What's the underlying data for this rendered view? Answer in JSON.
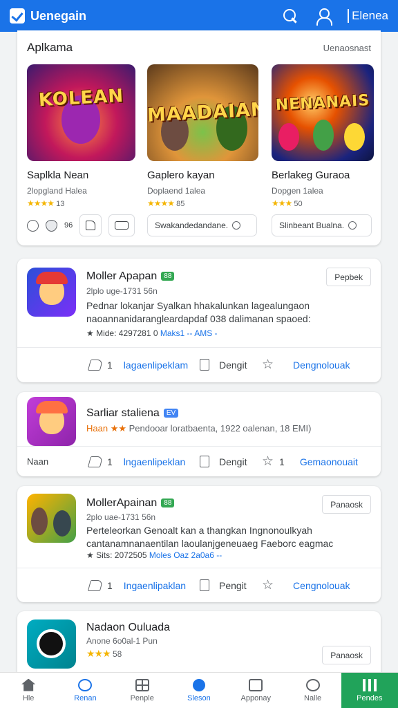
{
  "header": {
    "app_title": "Uenegain",
    "link_label": "Elenea"
  },
  "featured": {
    "title": "Aplkama",
    "more": "Uenaosnast",
    "items": [
      {
        "banner_text": "KOLEAN",
        "name": "Saplkla Nean",
        "sub": "2lopgland Halea",
        "stars": "★★★★",
        "rating": "13"
      },
      {
        "banner_text": "MAADAIAN",
        "name": "Gaplero kayan",
        "sub": "Doplaend 1alea",
        "stars": "★★★★",
        "rating": "85"
      },
      {
        "banner_text": "NENANAIS",
        "name": "Berlakeg Guraoa",
        "sub": "Dopgen 1alea",
        "stars": "★★★",
        "rating": "50"
      }
    ],
    "mini_count": "96",
    "actions": [
      "Swakandedandane.",
      "Slinbeant Bualna."
    ]
  },
  "apps": [
    {
      "name": "Moller Apapan",
      "tag": "88",
      "meta": "2lplo uge-1731 56n",
      "desc": "Pednar lokanjar Syalkan hhakalunkan lagealungaon naoannanidarangleardapdaf 038 dalimanan spaoed:",
      "stats_prefix": "★ Mide:",
      "stats_value": "4297281 0",
      "stats_link": "Maks1 -- AMS -",
      "button": "Pepbek",
      "share_count": "1",
      "share_label": "lagaenlipeklam",
      "doc_label": "Dengit",
      "star_label": "Dengnolouak"
    },
    {
      "name": "Sarliar staliena",
      "tag": "EV",
      "meta_prefix": "Haan ★★",
      "meta": "Pendooar loratbaenta, 1922 oalenan, 18 EMI)",
      "lead": "Naan",
      "share_count": "1",
      "share_label": "lngaenlipeklan",
      "doc_label": "Dengit",
      "star_count": "1",
      "star_label": "Gemaonouait"
    },
    {
      "name": "MollerApainan",
      "tag": "88",
      "meta": "2plo uae-1731 56n",
      "desc": "Perteleorkan Genoalt kan a thangkan Ingnonoulkyah cantanamnanaentilan laoulanjgeneuaeg Faeborc eagmac",
      "stats_prefix": "★ Sits:",
      "stats_value": "2072505",
      "stats_link": "Moles Oaz 2a0a6 --",
      "button": "Panaosk",
      "share_count": "1",
      "share_label": "Ingaenlipaklan",
      "doc_label": "Pengit",
      "star_label": "Cengnolouak"
    },
    {
      "name": "Nadaon Ouluada",
      "meta": "Anone 6o0al-1 Pun",
      "stars": "★★★",
      "rating": "58",
      "button": "Panaosk"
    }
  ],
  "bottom_nav": [
    {
      "label": "Hle",
      "icon": "home-icon"
    },
    {
      "label": "Renan",
      "icon": "bot-icon"
    },
    {
      "label": "Penple",
      "icon": "grid-icon"
    },
    {
      "label": "Sleson",
      "icon": "location-icon"
    },
    {
      "label": "Apponay",
      "icon": "photo-icon"
    },
    {
      "label": "Nalle",
      "icon": "dots-icon"
    },
    {
      "label": "Pendes",
      "icon": "bars-icon"
    }
  ],
  "colors": {
    "primary": "#1a73e8",
    "accent_green": "#21a35a",
    "star": "#f4b400"
  }
}
